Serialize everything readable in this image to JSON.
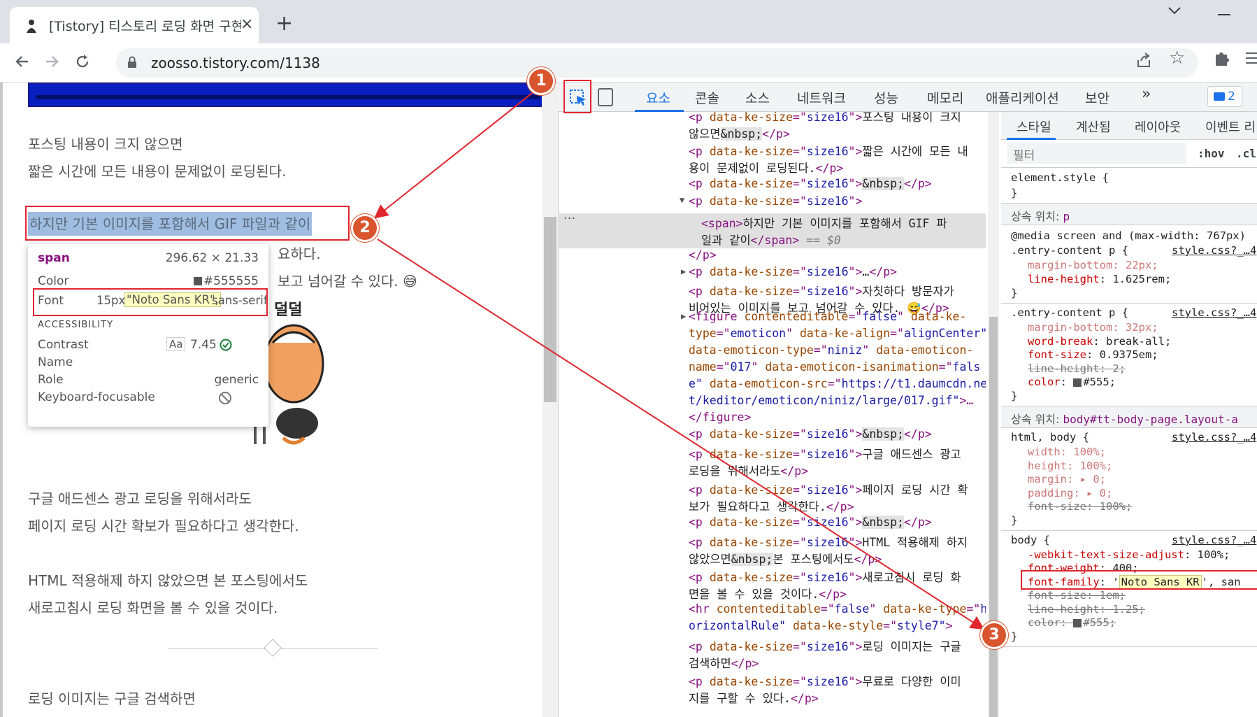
{
  "browser": {
    "tab_title": "[Tistory] 티스토리 로딩 화면 구현",
    "new_tab": "+",
    "tab_close": "×",
    "url": "zoosso.tistory.com/1138",
    "icons": {
      "back": "back-arrow-icon",
      "forward": "forward-arrow-icon",
      "reload": "reload-icon",
      "lock": "lock-icon",
      "share": "share-icon",
      "star": "star-icon",
      "extensions": "puzzle-icon",
      "menu": "menu-icon"
    }
  },
  "page": {
    "p1": "포스팅 내용이 크지 않으면",
    "p2": "짧은 시간에 모든 내용이 문제없이 로딩된다.",
    "selected": "하지만 기본 이미지를 포함해서 GIF 파일과 같이",
    "p4_tail": "요하다.",
    "p5_tail": "보고 넘어갈 수 있다. 😅",
    "emoticon_caption": "덜덜",
    "p6": "구글 애드센스 광고 로딩을 위해서라도",
    "p7": "페이지 로딩 시간 확보가 필요하다고 생각한다.",
    "p8": "HTML 적용해제 하지 않았으면 본 포스팅에서도",
    "p9": "새로고침시 로딩 화면을 볼 수 있을 것이다.",
    "p10": "로딩 이미지는 구글 검색하면"
  },
  "tooltip": {
    "tag": "span",
    "size": "296.62 × 21.33",
    "color_label": "Color",
    "color_value": "#555555",
    "font_label": "Font",
    "font_size": "15px",
    "font_name": "\"Noto Sans KR\",",
    "font_fallback": "sans-serif",
    "accessibility": "ACCESSIBILITY",
    "contrast_label": "Contrast",
    "contrast_aa": "Aa",
    "contrast_value": "7.45",
    "name_label": "Name",
    "role_label": "Role",
    "role_value": "generic",
    "kbd_label": "Keyboard-focusable"
  },
  "devtools": {
    "tabs": [
      "요소",
      "콘솔",
      "소스",
      "네트워크",
      "성능",
      "메모리",
      "애플리케이션",
      "보안"
    ],
    "more": "»",
    "issues_count": "2",
    "styles_tabs": [
      "스타일",
      "계산됨",
      "레이아웃",
      "이벤트 리"
    ],
    "filter_placeholder": "필터",
    "hov": ":hov",
    "cls": ".cl",
    "dom": {
      "l01": {
        "a": "<p ",
        "n": "data-ke-size",
        "e": "=\"",
        "v": "size16",
        "c": "\">",
        "t": "포스팅 내용이 크지"
      },
      "l02": {
        "t": "않으면",
        "ent": "&nbsp;",
        "end": "</p>"
      },
      "l03": {
        "a": "<p ",
        "n": "data-ke-size",
        "e": "=\"",
        "v": "size16",
        "c": "\">",
        "t": "짧은 시간에 모든 내"
      },
      "l04": {
        "t": "용이 문제없이 로딩된다.",
        "end": "</p>"
      },
      "l05": {
        "a": "<p ",
        "n": "data-ke-size",
        "e": "=\"",
        "v": "size16",
        "c": "\">",
        "ent": "&nbsp;",
        "end": "</p>"
      },
      "l06": {
        "a": "<p ",
        "n": "data-ke-size",
        "e": "=\"",
        "v": "size16",
        "c": "\">"
      },
      "l07": {
        "a": "<span>",
        "t": "하지만 기본 이미지를 포함해서 GIF 파"
      },
      "l08": {
        "t": "일과 같이",
        "end": "</span>",
        "dollar": " == $0"
      },
      "l09": {
        "end": "</p>"
      },
      "l10": {
        "a": "<p ",
        "n": "data-ke-size",
        "e": "=\"",
        "v": "size16",
        "c": "\">",
        "t": "…",
        "end": "</p>"
      },
      "l11": {
        "a": "<p ",
        "n": "data-ke-size",
        "e": "=\"",
        "v": "size16",
        "c": "\">",
        "t": "자칫하다 방문자가"
      },
      "l12": {
        "t": "비어있는 이미지를 보고 넘어갈 수 있다. 😅",
        "end": "</p>"
      },
      "l13": {
        "a": "<figure ",
        "n": "contenteditable",
        "e": "=\"",
        "v": "false",
        "c": "\" ",
        "n2": "data-ke-"
      },
      "l14": {
        "n": "type",
        "e": "=\"",
        "v": "emoticon",
        "c": "\" ",
        "n2": "data-ke-align",
        "e2": "=\"",
        "v2": "alignCenter\""
      },
      "l15": {
        "n": "data-emoticon-type",
        "e": "=\"",
        "v": "niniz",
        "c": "\" ",
        "n2": "data-emoticon-"
      },
      "l16": {
        "n": "name",
        "e": "=\"",
        "v": "017",
        "c": "\" ",
        "n2": "data-emoticon-isanimation",
        "e2": "=\"",
        "v2": "fals"
      },
      "l17": {
        "v": "e\"",
        "c": " ",
        "n": "data-emoticon-src",
        "e": "=\"",
        "v2": "https://t1.daumcdn.ne"
      },
      "l18": {
        "v": "t/keditor/emoticon/niniz/large/017.gif\"",
        "c": ">…"
      },
      "l19": {
        "end": "</figure>"
      },
      "l20": {
        "a": "<p ",
        "n": "data-ke-size",
        "e": "=\"",
        "v": "size16",
        "c": "\">",
        "ent": "&nbsp;",
        "end": "</p>"
      },
      "l21": {
        "a": "<p ",
        "n": "data-ke-size",
        "e": "=\"",
        "v": "size16",
        "c": "\">",
        "t": "구글 애드센스 광고"
      },
      "l22": {
        "t": "로딩을 위해서라도",
        "end": "</p>"
      },
      "l23": {
        "a": "<p ",
        "n": "data-ke-size",
        "e": "=\"",
        "v": "size16",
        "c": "\">",
        "t": "페이지 로딩 시간 확"
      },
      "l24": {
        "t": "보가 필요하다고 생각한다.",
        "end": "</p>"
      },
      "l25": {
        "a": "<p ",
        "n": "data-ke-size",
        "e": "=\"",
        "v": "size16",
        "c": "\">",
        "ent": "&nbsp;",
        "end": "</p>"
      },
      "l26": {
        "a": "<p ",
        "n": "data-ke-size",
        "e": "=\"",
        "v": "size16",
        "c": "\">",
        "t": "HTML 적용해제 하지"
      },
      "l27": {
        "t": "않았으면",
        "ent": "&nbsp;",
        "t2": "본 포스팅에서도",
        "end": "</p>"
      },
      "l28": {
        "a": "<p ",
        "n": "data-ke-size",
        "e": "=\"",
        "v": "size16",
        "c": "\">",
        "t": "새로고침시 로딩 화"
      },
      "l29": {
        "t": "면을 볼 수 있을 것이다.",
        "end": "</p>"
      },
      "l30": {
        "a": "<hr ",
        "n": "contenteditable",
        "e": "=\"",
        "v": "false",
        "c": "\" ",
        "n2": "data-ke-type",
        "e2": "=\"",
        "v2": "h"
      },
      "l31": {
        "v": "orizontalRule\"",
        "c": " ",
        "n": "data-ke-style",
        "e": "=\"",
        "v2": "style7\"",
        "end": ">"
      },
      "l32": {
        "a": "<p ",
        "n": "data-ke-size",
        "e": "=\"",
        "v": "size16",
        "c": "\">",
        "t": "로딩 이미지는 구글"
      },
      "l33": {
        "t": "검색하면",
        "end": "</p>"
      },
      "l34": {
        "a": "<p ",
        "n": "data-ke-size",
        "e": "=\"",
        "v": "size16",
        "c": "\">",
        "t": "무료로 다양한 이미"
      },
      "l35": {
        "t": "지를 구할 수 있다.",
        "end": "</p>"
      }
    },
    "styles": {
      "element_style": "element.style {",
      "close": "}",
      "inh1_label": "상속 위치: ",
      "inh1_sel": "p",
      "media": "@media screen and (max-width: 767px)",
      "rule1_sel": ".entry-content p {",
      "rule1_src": "style.css?_…4",
      "r1_p1": "margin-bottom: 22px;",
      "r1_p2n": "line-height",
      "r1_p2v": ": 1.625rem;",
      "rule2_sel": ".entry-content p {",
      "rule2_src": "style.css?_…4",
      "r2_p1": "margin-bottom: 32px;",
      "r2_p2n": "word-break",
      "r2_p2v": ": break-all;",
      "r2_p3n": "font-size",
      "r2_p3v": ": 0.9375em;",
      "r2_p4": "line-height: 2;",
      "r2_p5n": "color",
      "r2_p5v": "#555;",
      "inh2_label": "상속 위치: ",
      "inh2_sel": "body#tt-body-page.layout-a",
      "rule3_sel": "html, body {",
      "rule3_src": "style.css?_…4",
      "r3_p1": "width: 100%;",
      "r3_p2": "height: 100%;",
      "r3_p3": "margin: ▸ 0;",
      "r3_p4": "padding: ▸ 0;",
      "r3_p5": "font-size: 100%;",
      "rule4_sel": "body {",
      "rule4_src": "style.css?_…4",
      "r4_p1n": "-webkit-text-size-adjust",
      "r4_p1v": ": 100%;",
      "r4_p2n": "font-weight",
      "r4_p2v": ": 400;",
      "r4_p3n": "font-family",
      "r4_p3a": ": '",
      "r4_p3v": "Noto Sans KR",
      "r4_p3b": "', san",
      "r4_p4": "font-size: 1em;",
      "r4_p5": "line-height: 1.25;",
      "r4_p6": "color: ",
      "r4_p6v": "#555;"
    }
  },
  "annotations": {
    "b1": "1",
    "b2": "2",
    "b3": "3"
  },
  "colors": {
    "annotation_red": "#e0262f",
    "badge": "#d9552e",
    "selection": "#9fbde0",
    "tag": "#881280",
    "attr": "#994500",
    "value": "#1a1aa6"
  }
}
